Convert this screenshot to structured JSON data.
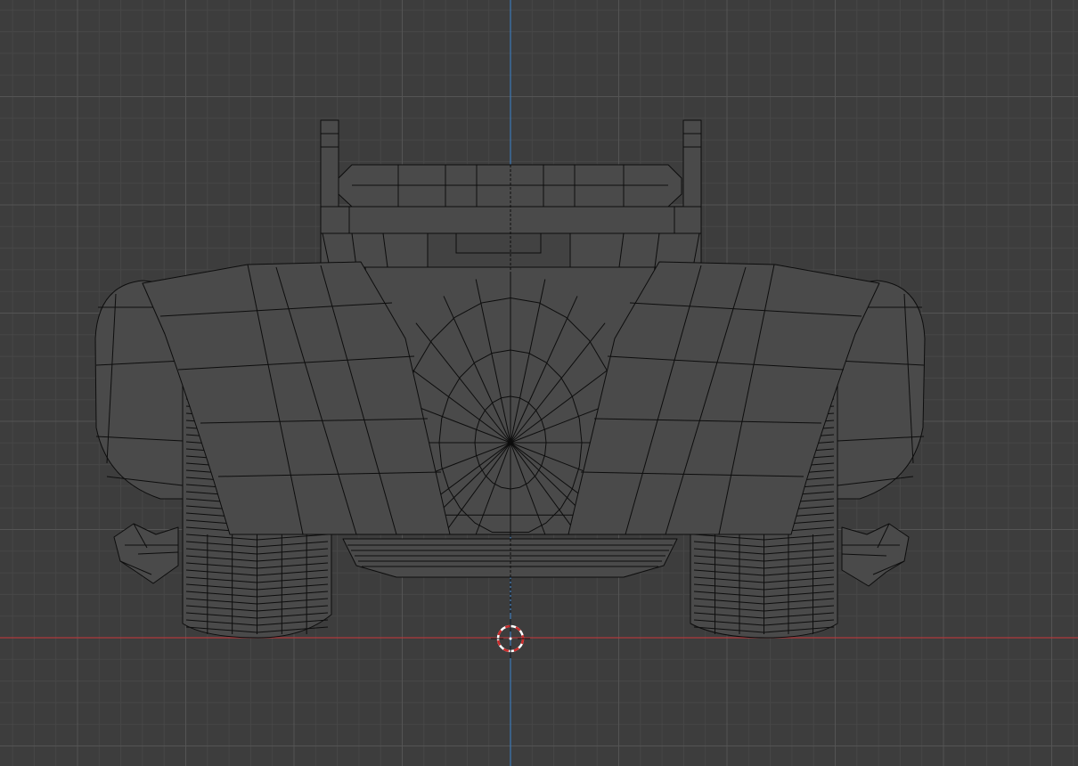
{
  "viewport": {
    "background": "#3d3d3d",
    "grid_minor_color": "#474747",
    "grid_major_color": "#545454",
    "x_axis_color": "#b0393c",
    "z_axis_color": "#3b79b8",
    "cursor_colors": [
      "#ffffff",
      "#cc2b2b"
    ],
    "mesh_fill": "#4a4a4a",
    "wire_color": "#0d0d0d",
    "objects": [
      {
        "name": "wheel-left-icon"
      },
      {
        "name": "wheel-right-icon"
      },
      {
        "name": "fender-left-icon"
      },
      {
        "name": "fender-right-icon"
      },
      {
        "name": "grille-icon"
      },
      {
        "name": "roll-bar-icon"
      },
      {
        "name": "exhaust-left-icon"
      },
      {
        "name": "exhaust-right-icon"
      }
    ]
  }
}
